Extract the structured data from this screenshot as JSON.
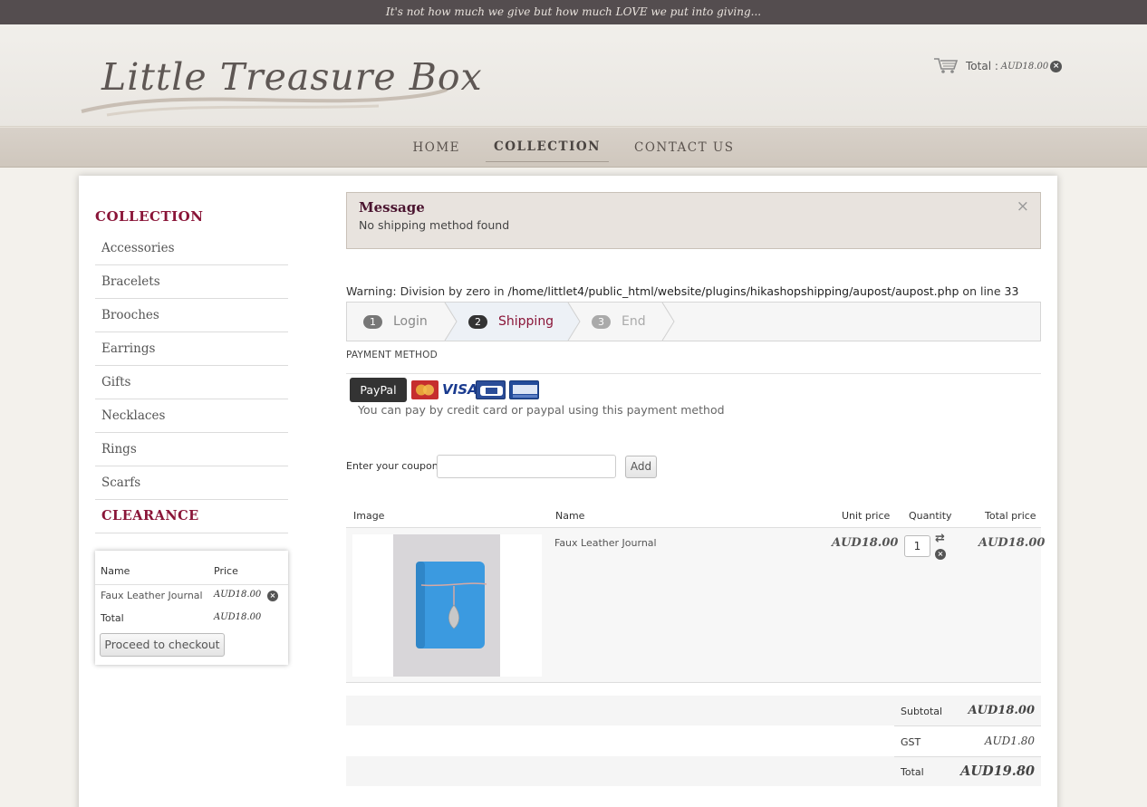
{
  "topbar": {
    "tagline": "It's not how much we give but how much LOVE we put into giving..."
  },
  "header": {
    "logo_text": "Little Treasure Box",
    "cart": {
      "total_label": "Total :",
      "total_amount": "AUD18.00"
    }
  },
  "nav": {
    "items": [
      "HOME",
      "COLLECTION",
      "CONTACT US"
    ],
    "active": "COLLECTION"
  },
  "sidebar": {
    "title": "COLLECTION",
    "categories": [
      "Accessories",
      "Bracelets",
      "Brooches",
      "Earrings",
      "Gifts",
      "Necklaces",
      "Rings",
      "Scarfs"
    ],
    "clearance": "CLEARANCE",
    "mini_cart": {
      "col_name": "Name",
      "col_price": "Price",
      "item_name": "Faux Leather Journal",
      "item_price": "AUD18.00",
      "total_label": "Total",
      "total_value": "AUD18.00",
      "checkout_button": "Proceed to checkout"
    }
  },
  "message": {
    "title": "Message",
    "text": "No shipping method found",
    "close": "×"
  },
  "warning": {
    "prefix": "Warning",
    "text": ": Division by zero in ",
    "path": "/home/littlet4/public_html/website/plugins/hikashopshipping/aupost/aupost.php",
    "on_line": " on line ",
    "line": "33"
  },
  "steps": [
    {
      "num": "1",
      "label": "Login",
      "state": "done"
    },
    {
      "num": "2",
      "label": "Shipping",
      "state": "active"
    },
    {
      "num": "3",
      "label": "End",
      "state": "pending"
    }
  ],
  "payment": {
    "section_label": "PAYMENT METHOD",
    "method_button": "PayPal",
    "cards": [
      "MasterCard",
      "VISA",
      "CB",
      "PayPal"
    ],
    "description": "You can pay by credit card or paypal using this payment method"
  },
  "coupon": {
    "label": "Enter your coupon",
    "value": "",
    "add_button": "Add"
  },
  "cart_table": {
    "headers": {
      "image": "Image",
      "name": "Name",
      "unit_price": "Unit price",
      "quantity": "Quantity",
      "total_price": "Total price"
    },
    "rows": [
      {
        "name": "Faux Leather Journal",
        "unit_price": "AUD18.00",
        "quantity": "1",
        "total_price": "AUD18.00"
      }
    ]
  },
  "totals": {
    "subtotal_label": "Subtotal",
    "subtotal": "AUD18.00",
    "gst_label": "GST",
    "gst": "AUD1.80",
    "total_label": "Total",
    "total": "AUD19.80"
  },
  "colors": {
    "accent": "#8a1538",
    "topbar": "#544d4f",
    "nav": "#d5cdc4",
    "message_bg": "#e8e3de"
  }
}
